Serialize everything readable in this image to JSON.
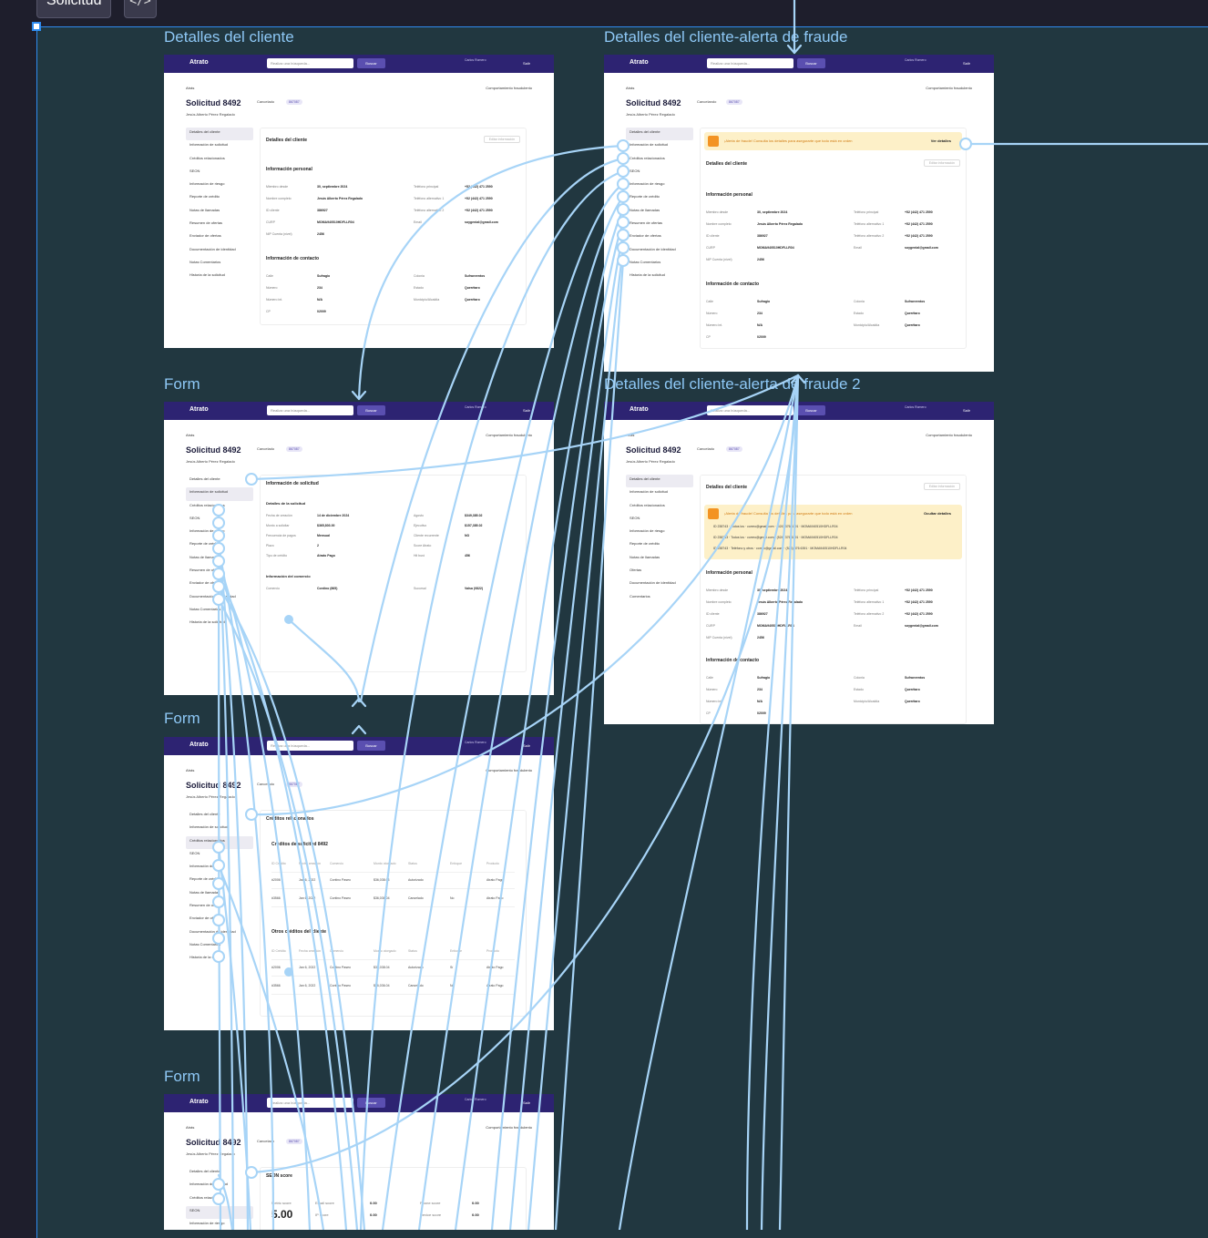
{
  "toolbar": {
    "section_label": "Solicitud",
    "code_label": "</>"
  },
  "frames": {
    "f1": {
      "title": "Detalles del cliente"
    },
    "f2": {
      "title": "Detalles del cliente-alerta de fraude"
    },
    "f3": {
      "title": "Form"
    },
    "f4": {
      "title": "Detalles del cliente-alerta de fraude 2"
    },
    "f5": {
      "title": "Form"
    },
    "f6": {
      "title": "Form"
    }
  },
  "app": {
    "logo": "Atrato",
    "search_select": "Teléfono",
    "search_placeholder": "Realiza una búsqueda...",
    "search_button": "Buscar",
    "user_name": "Carlos Romero",
    "user_email": "carlos.romero@atratopago.com",
    "exit": "Salir",
    "back": "Atrás",
    "fraud_report": "Comportamiento fraudulento",
    "request_title": "Solicitud 8492",
    "status": "Cancelado",
    "status_cancelling": "Cancelando",
    "credit": "Crédito ID",
    "credit_id": "867087",
    "client_name": "Jesús Alberto Pérez Regalado",
    "phone": "(442) 471 2590",
    "channel": "Contino",
    "email": "jesusregalado@mail.com"
  },
  "menu": [
    "Detalles del cliente",
    "Información de solicitud",
    "Créditos relacionados",
    "SEON",
    "Información de riesgo",
    "Reporte de crédito",
    "Notas de llamadas",
    "Resumen de ofertas",
    "Enviador de ofertas",
    "Documentación de identidad",
    "Notas Comentarios",
    "Historia de la solicitud"
  ],
  "menu_alt": [
    "Detalles del cliente",
    "Información de solicitud",
    "Créditos relacionados",
    "SEON",
    "Información de riesgo",
    "Reporte de crédito",
    "Notas de llamadas",
    "Ofertas",
    "Documentación de identidad",
    "Comentarios"
  ],
  "client_details": {
    "card_title": "Detalles del cliente",
    "edit": "Editar información",
    "personal_title": "Información personal",
    "contact_title": "Información de contacto",
    "personal_rows": [
      {
        "l1": "Miembro desde",
        "v1": "30, septiembre 2024",
        "l2": "Teléfono principal",
        "v2": "+52 (442) 471 2590"
      },
      {
        "l1": "Nombre completo",
        "v1": "Jesús Alberto Pérez Regalado",
        "l2": "Teléfono alternativo 1",
        "v2": "+52 (442) 471 2590"
      },
      {
        "l1": "ID cliente",
        "v1": "386927",
        "l2": "Teléfono alternativo 2",
        "v2": "+52 (442) 471 2590"
      },
      {
        "l1": "CURP",
        "v1": "MOMA940510HDFLLR04",
        "l2": "Email",
        "v2": "soygenial@gmail.com"
      },
      {
        "l1": "NIP Cuenta (nivel)",
        "v1": "2456",
        "l2": "",
        "v2": ""
      }
    ],
    "contact_rows": [
      {
        "l1": "Calle",
        "v1": "Sufragio",
        "l2": "Colonia",
        "v2": "Sufraeventos"
      },
      {
        "l1": "Número",
        "v1": "234",
        "l2": "Estado",
        "v2": "Querétaro"
      },
      {
        "l1": "Número int.",
        "v1": "N/A",
        "l2": "Municipio/Alcaldía",
        "v2": "Querétaro"
      },
      {
        "l1": "CP",
        "v1": "02009",
        "l2": "",
        "v2": ""
      }
    ]
  },
  "fraud_alert": {
    "text": "¡Alerta de fraude! Consulta los detalles para asegurarte que todo está en orden",
    "see_details": "Ver detalles",
    "hide_details": "Ocultar detalles",
    "rows": [
      "ID 238743 · Todos los · correo@gmail.com · (524) 376 6391 · MOMA940510HDFLLR04",
      "ID 238743 · Todos los · correo@gmail.com · (524) 376 6391 · MOMA940510HDFLLR04",
      "ID 238743 · Teléfono y otros · correo@gmail.com · (524) 376 6391 · MOMA940510HDFLLR04"
    ]
  },
  "request_info": {
    "card_title": "Información de solicitud",
    "details_title": "Detalles de la solicitud",
    "merchant_title": "Información del comercio",
    "rows": [
      {
        "l1": "Fecha de creación",
        "v1": "14 de diciembre 2024",
        "l2": "Agosto",
        "v2": "$349,385.02"
      },
      {
        "l1": "Monto a solicitar",
        "v1": "$365,803.00",
        "l2": "Ejecutivo",
        "v2": "$157,385.02"
      },
      {
        "l1": "Frecuencia de pagos",
        "v1": "Mensual",
        "l2": "Cliente recurrente",
        "v2": "NO"
      },
      {
        "l1": "Plazo",
        "v1": "2",
        "l2": "Score Atrato",
        "v2": ""
      },
      {
        "l1": "Tipo de crédito",
        "v1": "Atrato Pago",
        "l2": "Hit buró",
        "v2": "456"
      }
    ],
    "merchant_rows": [
      {
        "l1": "Comercio",
        "v1": "Contino (865)",
        "l2": "Sucursal",
        "v2": "Valsa (0822)"
      }
    ]
  },
  "related_credits": {
    "card_title": "Créditos relacionados",
    "table1_title": "Créditos de solicitud 8492",
    "table2_title": "Otros créditos del cliente",
    "headers": [
      "ID Crédito",
      "Fecha creación",
      "Comercio",
      "Monto otorgado",
      "Status",
      "Enfoque",
      "Producto"
    ],
    "rows1": [
      [
        "#2006",
        "Jan 6, 2022",
        "Contino Paseo",
        "$36,038.04",
        "Autorizado",
        "Sí",
        "Atrato Pago"
      ],
      [
        "#3566",
        "Jan 6, 2022",
        "Contino Paseo",
        "$36,036.04",
        "Cancelado",
        "No",
        "Atrato Pago"
      ]
    ],
    "rows2": [
      [
        "#2006",
        "Jan 6, 2022",
        "Contino Paseo",
        "$36,038.04",
        "Autorizado",
        "Sí",
        "Atrato Pago"
      ],
      [
        "#3566",
        "Jan 6, 2022",
        "Contino Paseo",
        "$36,036.04",
        "Cancelado",
        "No",
        "Atrato Pago"
      ]
    ]
  },
  "seon": {
    "card_title": "SEON score",
    "metric_label": "Metric score",
    "metric_value": "5.00",
    "email_label": "Email score",
    "email_value": "0.00",
    "ip_label": "IP score",
    "ip_value": "0.00",
    "phone_label": "Phone score",
    "phone_value": "0.00",
    "device_label": "Device score",
    "device_value": "0.00"
  },
  "colors": {
    "canvas": "#1e1e2c",
    "section": "#213740",
    "accent": "#2f8cf0",
    "wire": "#a7d4f7",
    "header": "#2d2372",
    "alert": "#f39322"
  }
}
